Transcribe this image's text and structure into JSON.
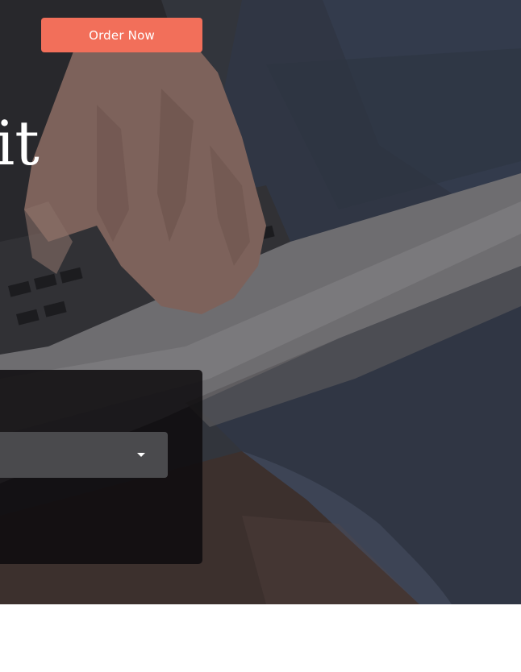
{
  "header": {
    "order_button_label": "Order Now"
  },
  "hero": {
    "heading_fragment": "it"
  },
  "form": {
    "select_value": ""
  },
  "colors": {
    "accent": "#f26f5a",
    "panel": "#0e0c0e",
    "select": "#4a4a4d"
  },
  "icons": {
    "select_caret": "chevron-down-icon"
  }
}
